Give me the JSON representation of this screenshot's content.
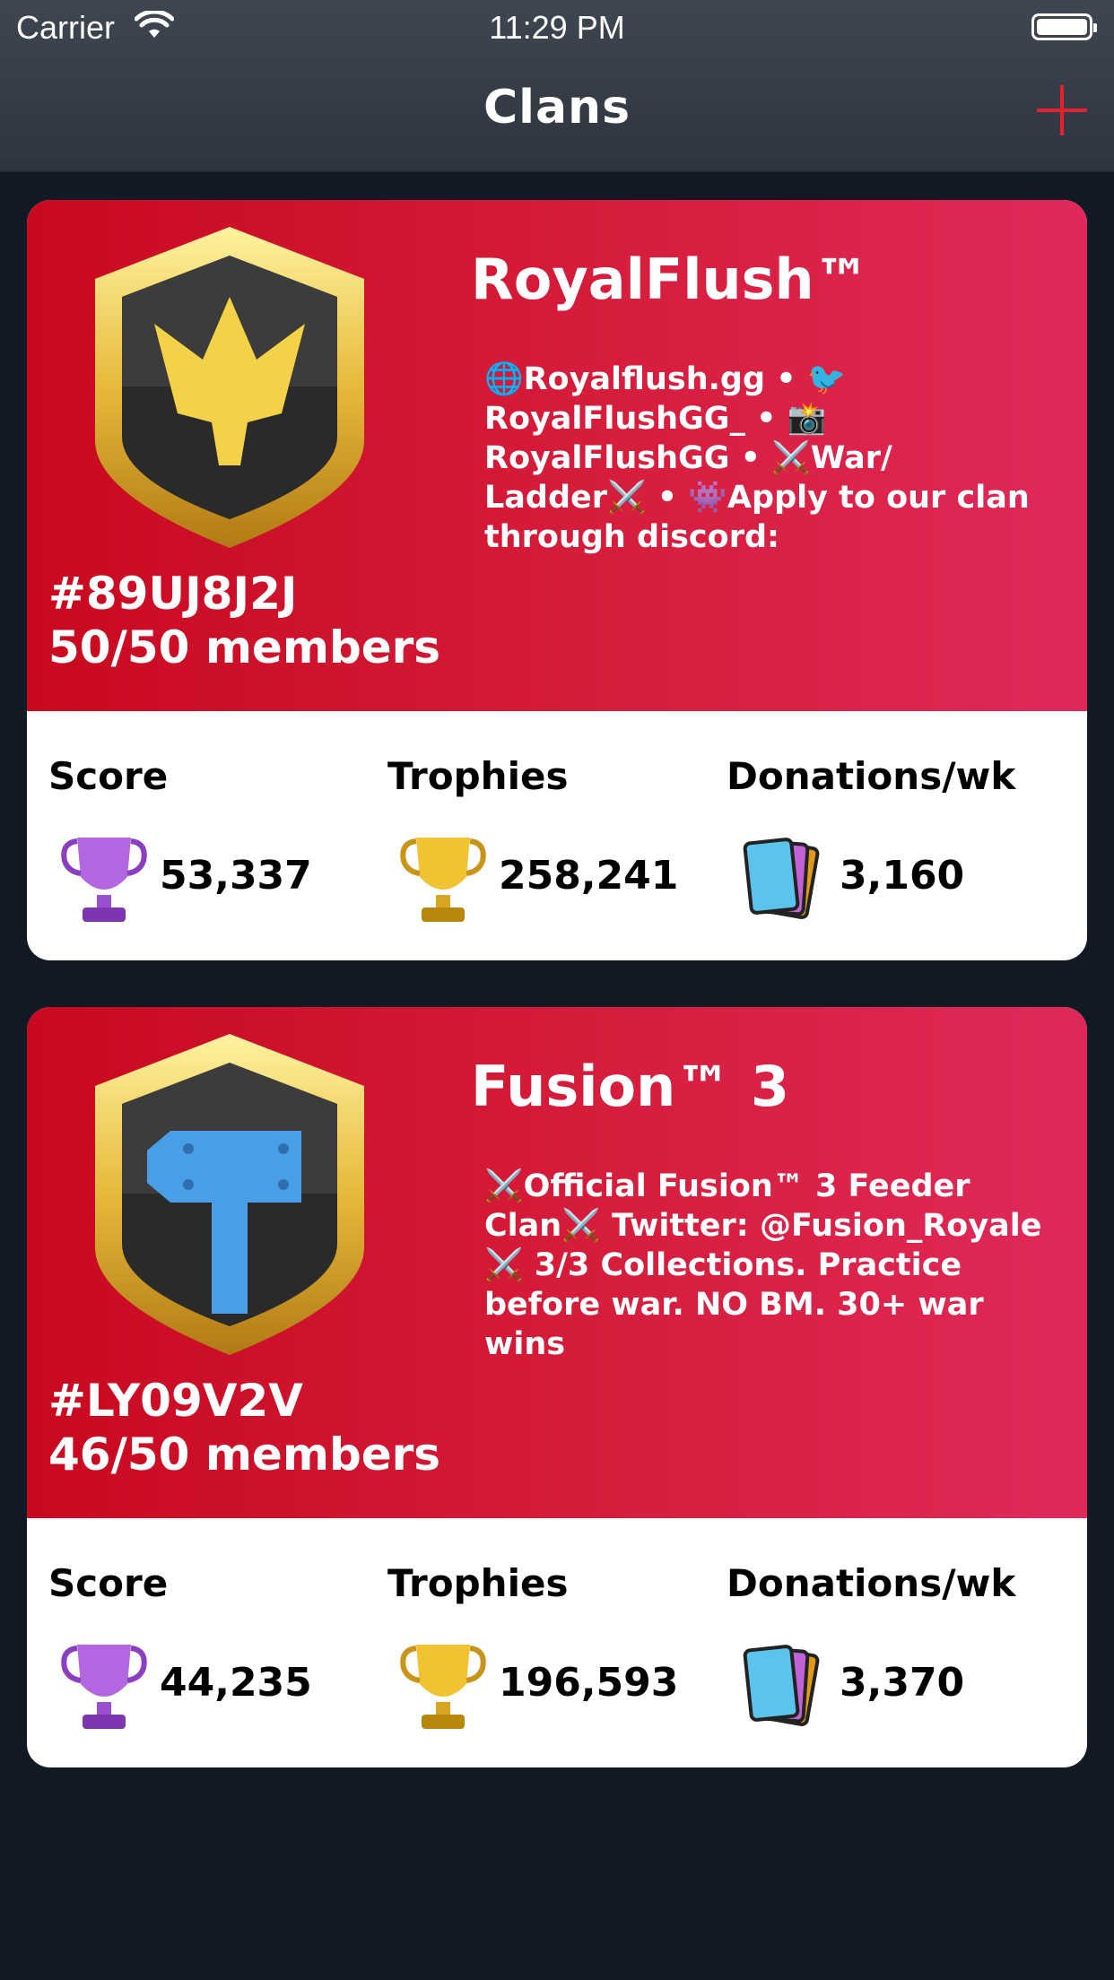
{
  "status_bar": {
    "carrier": "Carrier",
    "time": "11:29 PM"
  },
  "nav": {
    "title": "Clans",
    "add_icon": "plus-icon",
    "accent_color": "#e5202f"
  },
  "clans": [
    {
      "name": "RoyalFlush™",
      "description": "🌐Royalflush.gg • 🐦 RoyalFlushGG_ • 📸 RoyalFlushGG • ⚔️War/ Ladder⚔️ • 👾Apply to our clan through discord:",
      "tag": "#89UJ8J2J",
      "members": "50/50 members",
      "badge_icon": "crown-badge-icon",
      "stats": {
        "score_label": "Score",
        "score_value": "53,337",
        "trophies_label": "Trophies",
        "trophies_value": "258,241",
        "donations_label": "Donations/wk",
        "donations_value": "3,160"
      }
    },
    {
      "name": "Fusion™ 3",
      "description": "⚔️Official Fusion™ 3 Feeder Clan⚔️ Twitter: @Fusion_Royale ⚔️ 3/3 Collections. Practice before war. NO BM. 30+ war wins",
      "tag": "#LY09V2V",
      "members": "46/50 members",
      "badge_icon": "hammer-badge-icon",
      "stats": {
        "score_label": "Score",
        "score_value": "44,235",
        "trophies_label": "Trophies",
        "trophies_value": "196,593",
        "donations_label": "Donations/wk",
        "donations_value": "3,370"
      }
    }
  ],
  "colors": {
    "background": "#111925",
    "card_red": "#d01a35",
    "card_white": "#ffffff"
  }
}
